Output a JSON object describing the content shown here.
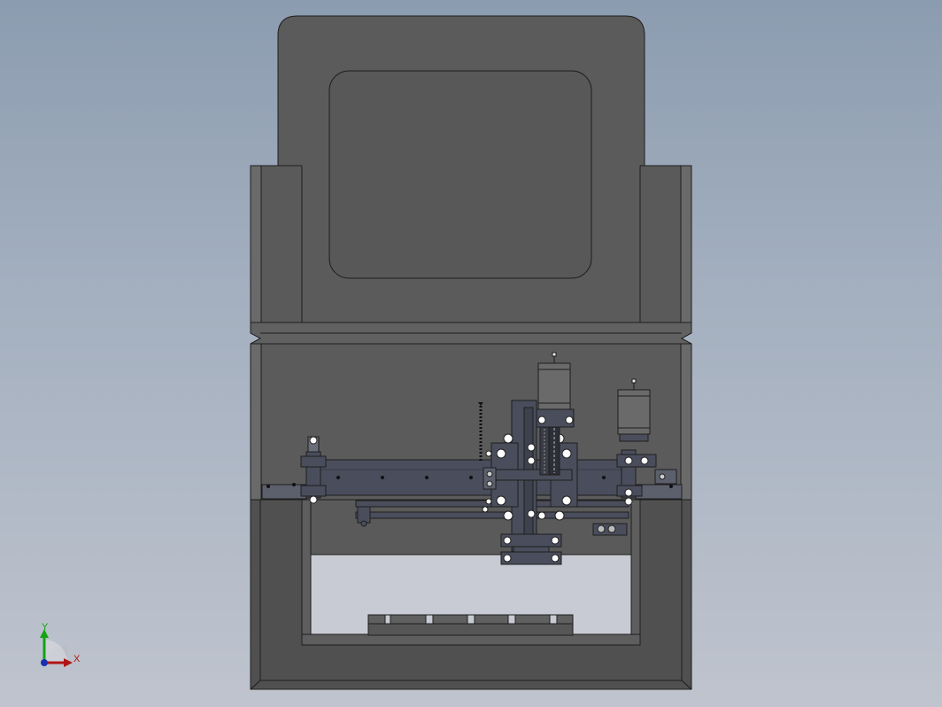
{
  "viewport": {
    "background_top": "#8c9cb0",
    "background_bottom": "#bfc4ce"
  },
  "model": {
    "body_color": "#5b5b5b",
    "panel_color": "#555555",
    "edge_color": "#1e1e1e",
    "metal_color": "#4a4d5c",
    "motor_color": "#6a6a6a",
    "opening_color": "#c8cbd3"
  },
  "triad": {
    "x_label": "X",
    "y_label": "Y",
    "x_color": "#b01515",
    "y_color": "#13a313",
    "z_color": "#1a2fb0"
  }
}
